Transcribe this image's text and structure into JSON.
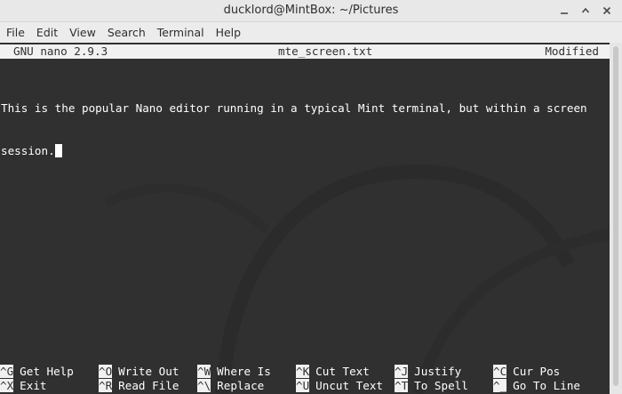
{
  "window": {
    "title": "ducklord@MintBox: ~/Pictures"
  },
  "menu": [
    "File",
    "Edit",
    "View",
    "Search",
    "Terminal",
    "Help"
  ],
  "nano": {
    "version": "GNU nano 2.9.3",
    "filename": "mte_screen.txt",
    "status": "Modified",
    "lines": [
      "This is the popular Nano editor running in a typical Mint terminal, but within a screen",
      "session."
    ]
  },
  "shortcuts": {
    "row1": [
      {
        "key": "^G",
        "label": "Get Help"
      },
      {
        "key": "^O",
        "label": "Write Out"
      },
      {
        "key": "^W",
        "label": "Where Is"
      },
      {
        "key": "^K",
        "label": "Cut Text"
      },
      {
        "key": "^J",
        "label": "Justify"
      },
      {
        "key": "^C",
        "label": "Cur Pos"
      }
    ],
    "row2": [
      {
        "key": "^X",
        "label": "Exit"
      },
      {
        "key": "^R",
        "label": "Read File"
      },
      {
        "key": "^\\",
        "label": "Replace"
      },
      {
        "key": "^U",
        "label": "Uncut Text"
      },
      {
        "key": "^T",
        "label": "To Spell"
      },
      {
        "key": "^_",
        "label": "Go To Line"
      }
    ]
  },
  "colors": {
    "terminal_bg": "#303030",
    "terminal_fg": "#ffffff",
    "titlebar_bg": "#e8e8e8"
  }
}
